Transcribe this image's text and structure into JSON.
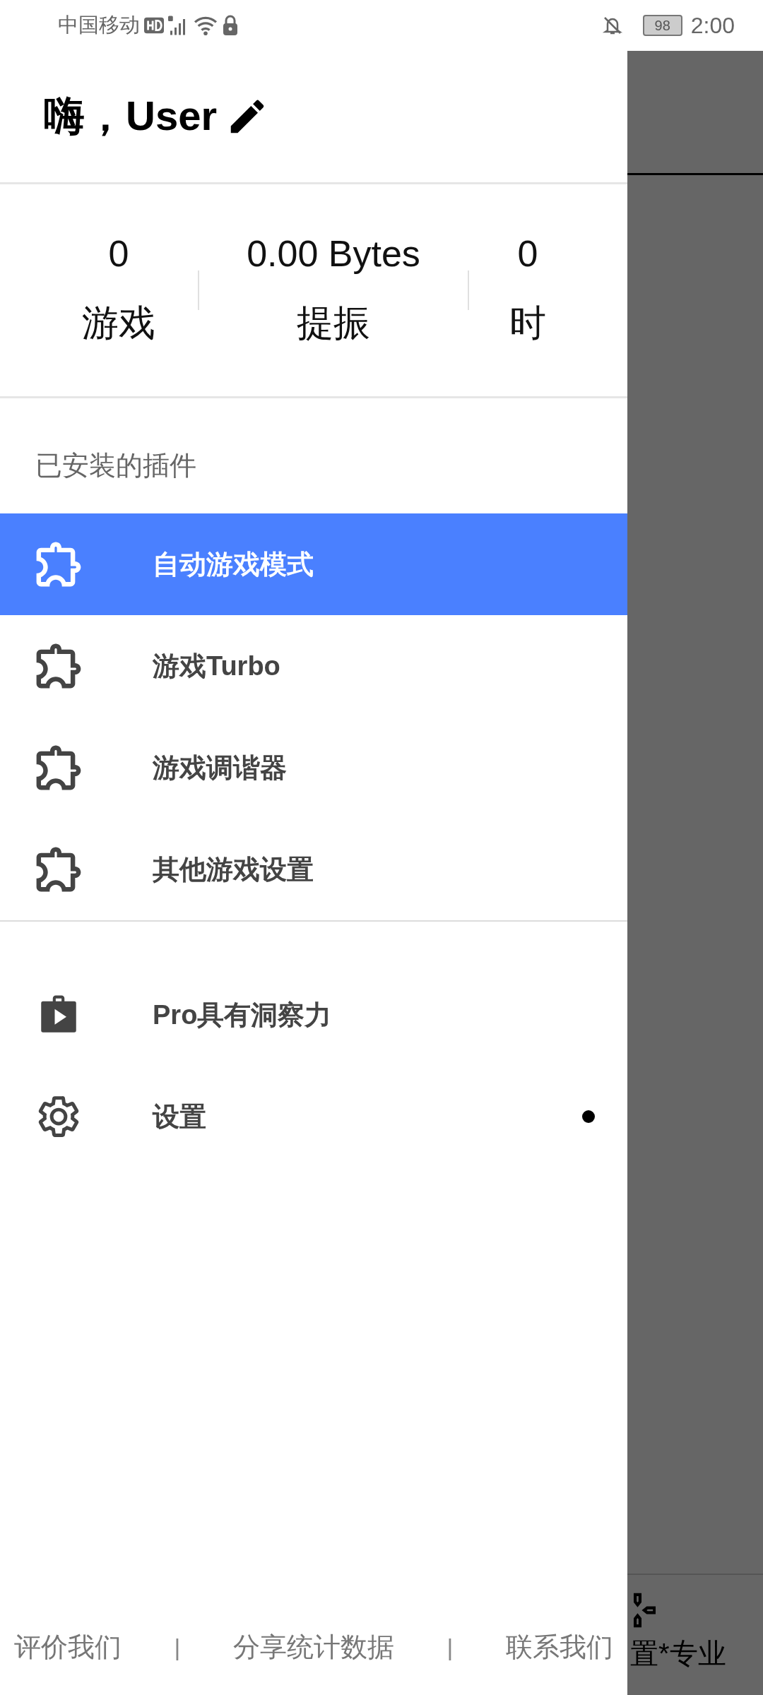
{
  "status_bar": {
    "carrier": "中国移动",
    "battery": "98",
    "time": "2:00"
  },
  "header": {
    "greeting": "嗨，User"
  },
  "stats": [
    {
      "value": "0",
      "label": "游戏"
    },
    {
      "value": "0.00 Bytes",
      "label": "提振"
    },
    {
      "value": "0",
      "label": "时"
    }
  ],
  "plugins": {
    "heading": "已安装的插件",
    "items": [
      {
        "label": "自动游戏模式",
        "selected": true
      },
      {
        "label": "游戏Turbo",
        "selected": false
      },
      {
        "label": "游戏调谐器",
        "selected": false
      },
      {
        "label": "其他游戏设置",
        "selected": false
      }
    ]
  },
  "menu": [
    {
      "kind": "pro",
      "label": "Pro具有洞察力",
      "dot": false
    },
    {
      "kind": "settings",
      "label": "设置",
      "dot": true
    }
  ],
  "footer": [
    {
      "kind": "link",
      "text": "评价我们"
    },
    {
      "kind": "separator",
      "text": "|"
    },
    {
      "kind": "link",
      "text": "分享统计数据"
    },
    {
      "kind": "separator",
      "text": "|"
    },
    {
      "kind": "link",
      "text": "联系我们"
    }
  ],
  "background": {
    "tab_label": "置*专业"
  }
}
